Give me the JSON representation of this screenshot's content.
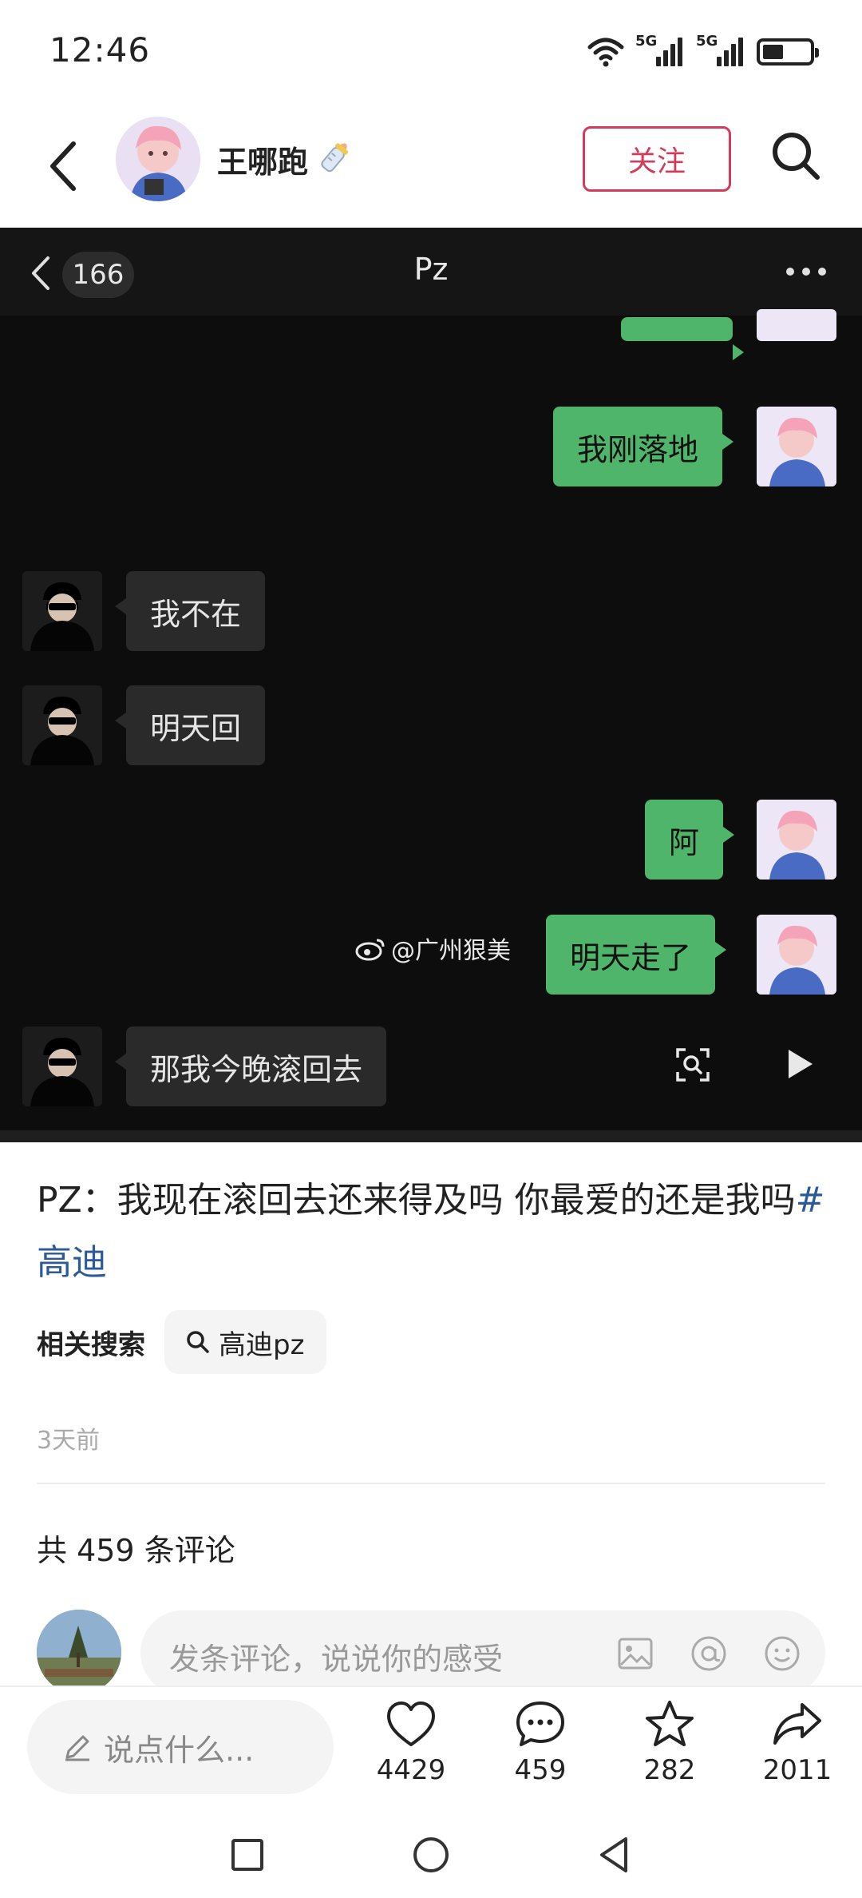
{
  "status_bar": {
    "time": "12:46",
    "network_1": "5G",
    "network_2": "5G",
    "battery_level": 0.45
  },
  "header": {
    "author_name": "王哪跑",
    "follow_label": "关注"
  },
  "chat_screenshot": {
    "back_badge": "166",
    "contact_name": "Pz",
    "messages": [
      {
        "from": "me",
        "text": "我刚落地"
      },
      {
        "from": "them",
        "text": "我不在"
      },
      {
        "from": "them",
        "text": "明天回"
      },
      {
        "from": "me",
        "text": "阿"
      },
      {
        "from": "me",
        "text": "明天走了"
      },
      {
        "from": "them",
        "text": "那我今晚滚回去"
      }
    ],
    "watermark": "@广州狠美"
  },
  "post": {
    "text": "PZ：我现在滚回去还来得及吗 你最爱的还是我吗",
    "hashtag": "#高迪",
    "related_label": "相关搜索",
    "related_query": "高迪pz",
    "time": "3天前",
    "comment_total": "共 459 条评论"
  },
  "comment_box": {
    "placeholder": "发条评论，说说你的感受"
  },
  "action_bar": {
    "say_placeholder": "说点什么...",
    "likes": "4429",
    "comments": "459",
    "favorites": "282",
    "shares": "2011"
  },
  "colors": {
    "accent": "#d43b5a",
    "hashtag": "#2b5a97",
    "my_bubble": "#4fb56b",
    "their_bubble": "#2a2a2a",
    "chat_bg": "#0d0d0d"
  }
}
